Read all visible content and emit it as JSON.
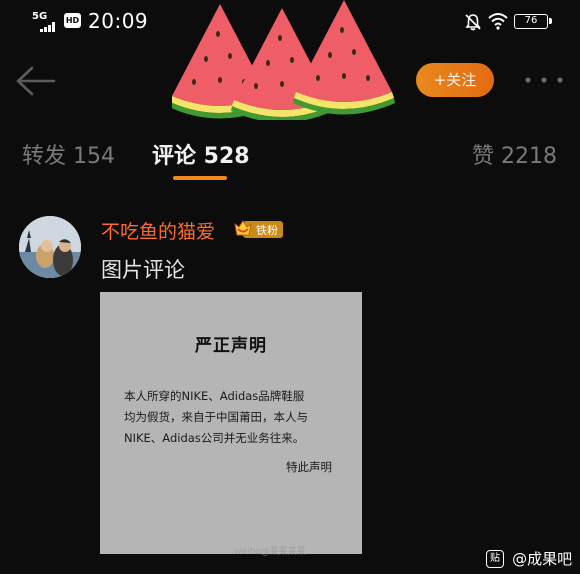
{
  "status_bar": {
    "network": "5G",
    "hd_label": "HD",
    "time": "20:09",
    "battery": "76"
  },
  "header": {
    "follow_label": "+关注"
  },
  "tabs": {
    "repost": "转发 154",
    "comments": "评论 528",
    "likes": "赞 2218"
  },
  "comment": {
    "username": "不吃鱼的猫爱",
    "badge": "铁粉",
    "text": "图片评论"
  },
  "notice": {
    "title": "严正声明",
    "lines": [
      "本人所穿的NIKE、Adidas品牌鞋服",
      "均为假货，来自于中国莆田，本人与",
      "NIKE、Adidas公司并无业务往来。"
    ],
    "sign": "特此声明",
    "watermark": "weibo@某某某某"
  },
  "site_watermark": {
    "icon_text": "贴",
    "text": "@成果吧"
  },
  "colors": {
    "accent_orange": "#f08a1f",
    "username_red": "#ff6a2f",
    "background": "#0c0c0c"
  },
  "icons": [
    "back-arrow-icon",
    "bell-off-icon",
    "wifi-icon",
    "battery-icon",
    "more-icon",
    "watermelon-decoration"
  ]
}
